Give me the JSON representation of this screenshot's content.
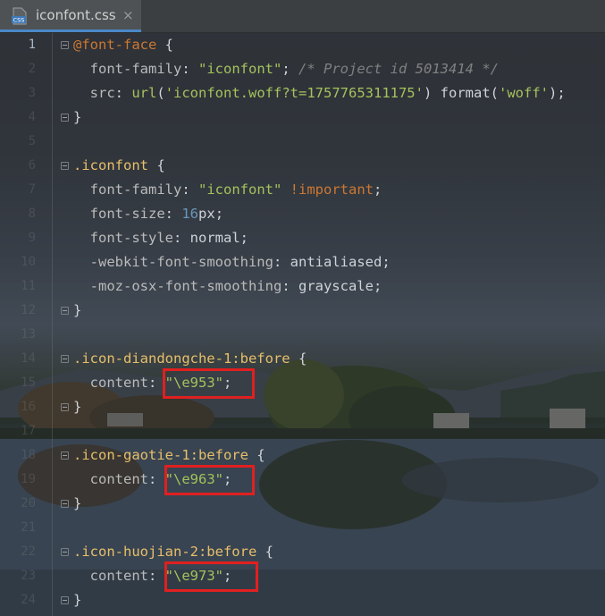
{
  "tab": {
    "label": "iconfont.css",
    "close": "×",
    "icon": "css-file-icon",
    "icon_text": "CSS"
  },
  "gutter": {
    "line_numbers": [
      "1",
      "2",
      "3",
      "4",
      "5",
      "6",
      "7",
      "8",
      "9",
      "10",
      "11",
      "12",
      "13",
      "14",
      "15",
      "16",
      "17",
      "18",
      "19",
      "20",
      "21",
      "22",
      "23",
      "24"
    ]
  },
  "code": {
    "l1": {
      "at": "@font-face",
      "brace": " {"
    },
    "l2": {
      "prop": "font-family",
      "str": "\"iconfont\"",
      "semi": ";",
      "comment": "/* Project id 5013414 */"
    },
    "l3": {
      "prop": "src",
      "fn": "url",
      "arg": "'iconfont.woff?t=1757765311175'",
      "fn2": "format",
      "arg2": "'woff'",
      "end": ");"
    },
    "l4": {
      "brace": "}"
    },
    "l6": {
      "sel": ".iconfont",
      "brace": " {"
    },
    "l7": {
      "prop": "font-family",
      "str": "\"iconfont\"",
      "imp": "!important",
      "semi": ";"
    },
    "l8": {
      "prop": "font-size",
      "num": "16",
      "unit": "px",
      "semi": ";"
    },
    "l9": {
      "prop": "font-style",
      "val": "normal",
      "semi": ";"
    },
    "l10": {
      "prop": "-webkit-font-smoothing",
      "val": "antialiased",
      "semi": ";"
    },
    "l11": {
      "prop": "-moz-osx-font-smoothing",
      "val": "grayscale",
      "semi": ";"
    },
    "l12": {
      "brace": "}"
    },
    "l14": {
      "sel": ".icon-diandongche-1:before",
      "brace": " {"
    },
    "l15": {
      "prop": "content",
      "str": "\"\\e953\"",
      "semi": ";"
    },
    "l16": {
      "brace": "}"
    },
    "l18": {
      "sel": ".icon-gaotie-1:before",
      "brace": " {"
    },
    "l19": {
      "prop": "content",
      "str": "\"\\e963\"",
      "semi": ";"
    },
    "l20": {
      "brace": "}"
    },
    "l22": {
      "sel": ".icon-huojian-2:before",
      "brace": " {"
    },
    "l23": {
      "prop": "content",
      "str": "\"\\e973\"",
      "semi": ";"
    },
    "l24": {
      "brace": "}"
    }
  },
  "colors": {
    "highlight_box": "#e02020",
    "tab_accent": "#4a88c7"
  }
}
